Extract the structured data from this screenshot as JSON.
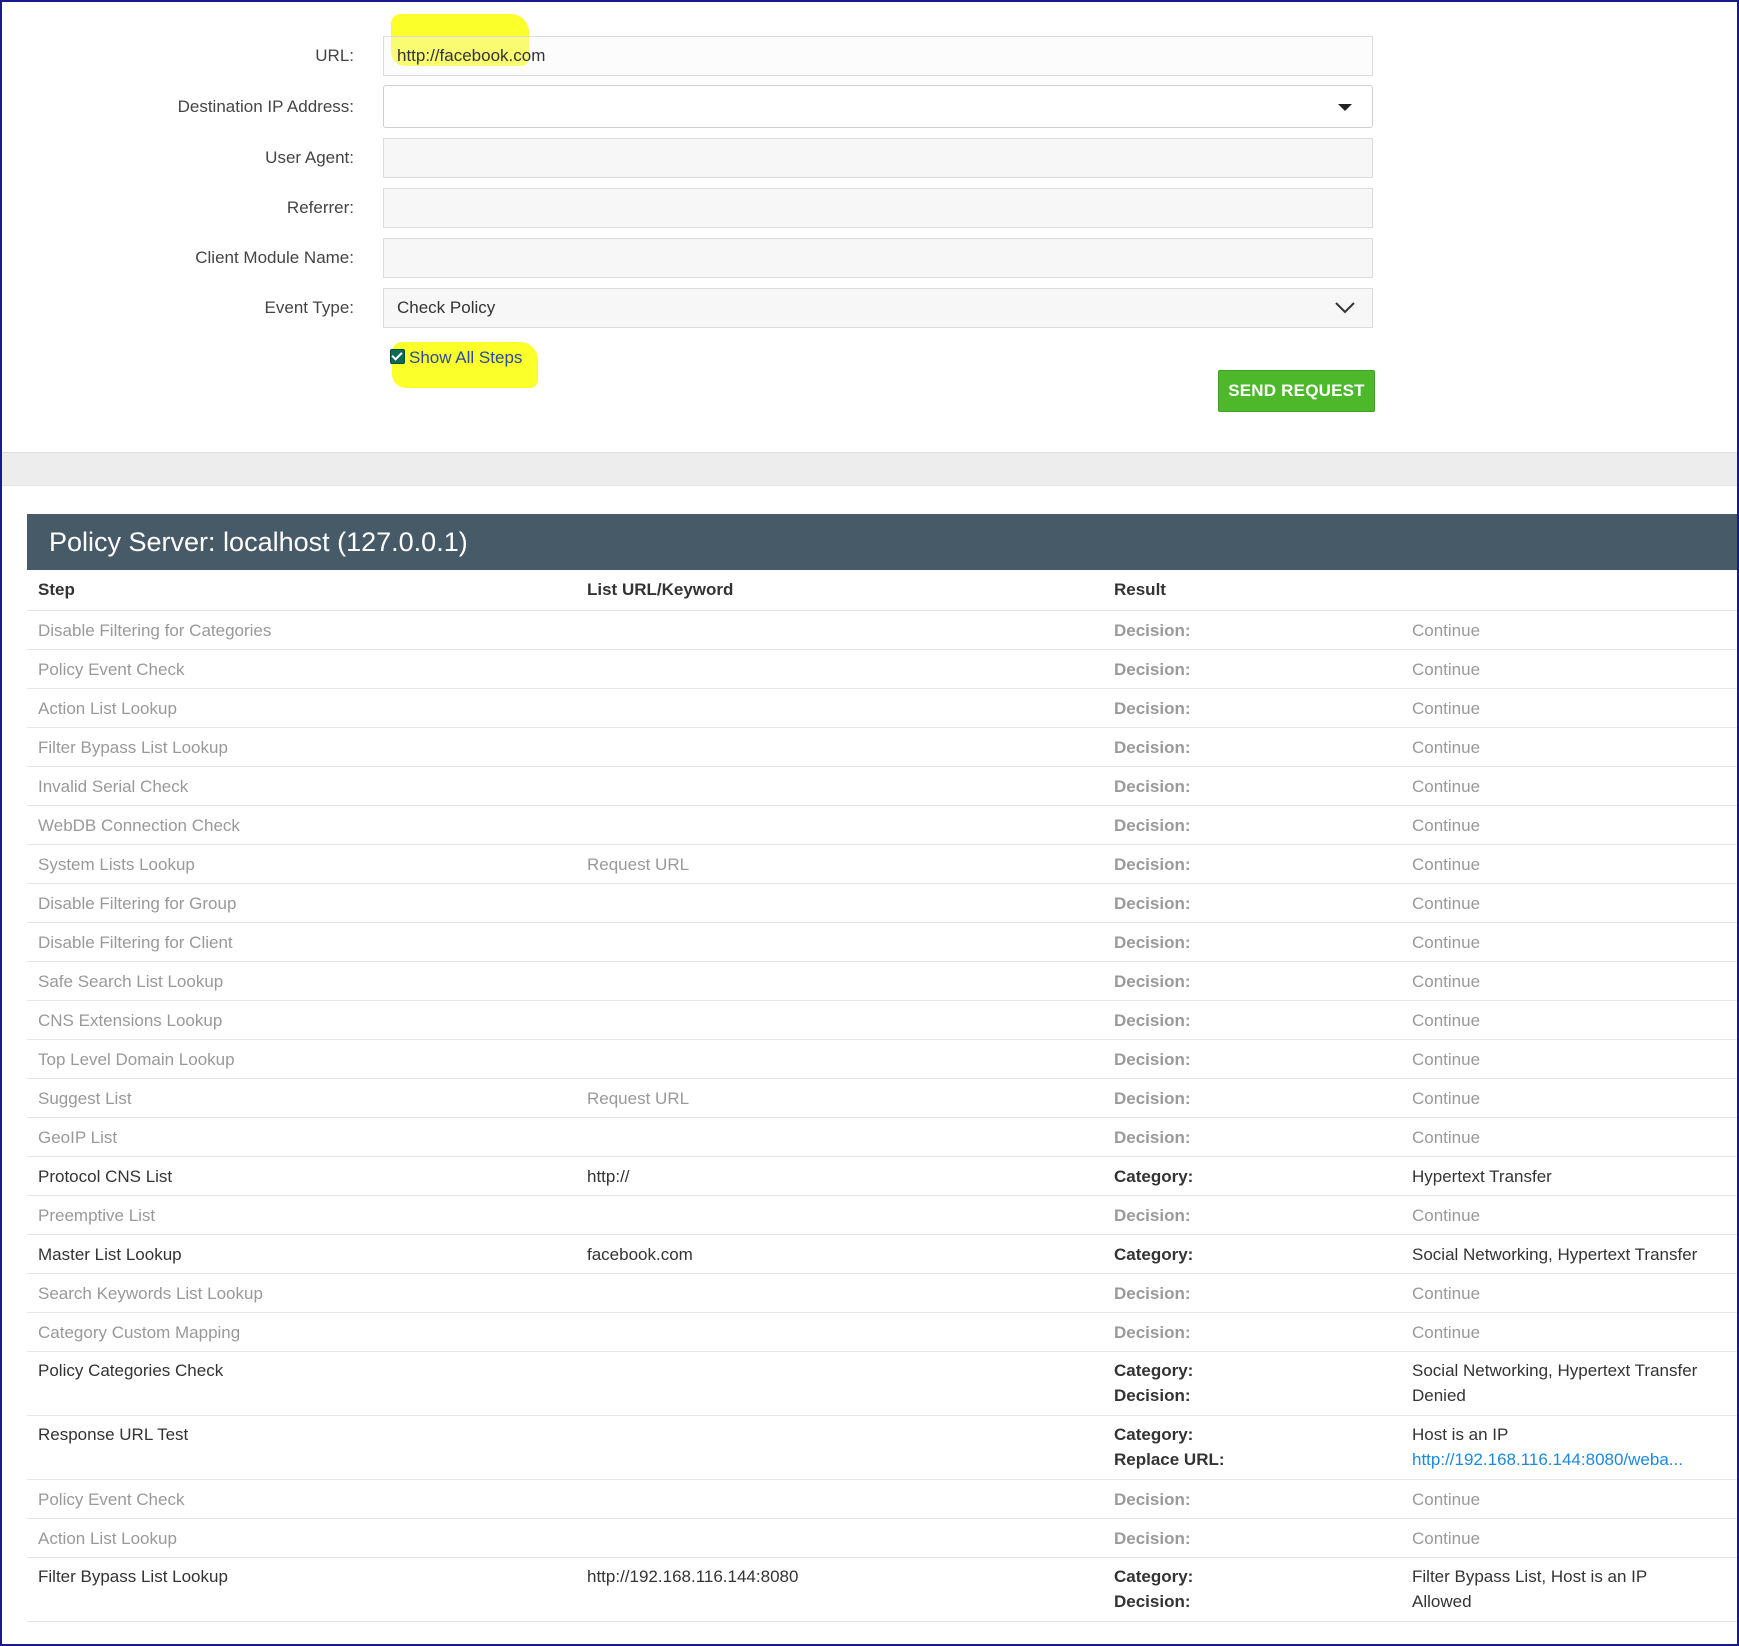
{
  "form": {
    "url_label": "URL:",
    "url_value": "http://facebook.com",
    "dest_ip_label": "Destination IP Address:",
    "dest_ip_value": "",
    "user_agent_label": "User Agent:",
    "referrer_label": "Referrer:",
    "client_module_label": "Client Module Name:",
    "event_type_label": "Event Type:",
    "event_type_value": "Check Policy",
    "show_all_steps_label": "Show All Steps",
    "show_all_steps_checked": true,
    "send_button": "SEND REQUEST"
  },
  "panel": {
    "title": "Policy Server: localhost (127.0.0.1)",
    "columns": [
      "Step",
      "List URL/Keyword",
      "Result",
      ""
    ],
    "rows": [
      {
        "step": "Disable Filtering for Categories",
        "keyword": "",
        "label1": "Decision:",
        "value1": "Continue"
      },
      {
        "step": "Policy Event Check",
        "keyword": "",
        "label1": "Decision:",
        "value1": "Continue"
      },
      {
        "step": "Action List Lookup",
        "keyword": "",
        "label1": "Decision:",
        "value1": "Continue"
      },
      {
        "step": "Filter Bypass List Lookup",
        "keyword": "",
        "label1": "Decision:",
        "value1": "Continue"
      },
      {
        "step": "Invalid Serial Check",
        "keyword": "",
        "label1": "Decision:",
        "value1": "Continue"
      },
      {
        "step": "WebDB Connection Check",
        "keyword": "",
        "label1": "Decision:",
        "value1": "Continue"
      },
      {
        "step": "System Lists Lookup",
        "keyword": "Request URL",
        "label1": "Decision:",
        "value1": "Continue"
      },
      {
        "step": "Disable Filtering for Group",
        "keyword": "",
        "label1": "Decision:",
        "value1": "Continue"
      },
      {
        "step": "Disable Filtering for Client",
        "keyword": "",
        "label1": "Decision:",
        "value1": "Continue"
      },
      {
        "step": "Safe Search List Lookup",
        "keyword": "",
        "label1": "Decision:",
        "value1": "Continue"
      },
      {
        "step": "CNS Extensions Lookup",
        "keyword": "",
        "label1": "Decision:",
        "value1": "Continue"
      },
      {
        "step": "Top Level Domain Lookup",
        "keyword": "",
        "label1": "Decision:",
        "value1": "Continue"
      },
      {
        "step": "Suggest List",
        "keyword": "Request URL",
        "label1": "Decision:",
        "value1": "Continue"
      },
      {
        "step": "GeoIP List",
        "keyword": "",
        "label1": "Decision:",
        "value1": "Continue"
      },
      {
        "step": "Protocol CNS List",
        "keyword": "http://",
        "label1": "Category:",
        "value1": "Hypertext Transfer"
      },
      {
        "step": "Preemptive List",
        "keyword": "",
        "label1": "Decision:",
        "value1": "Continue"
      },
      {
        "step": "Master List Lookup",
        "keyword": "facebook.com",
        "label1": "Category:",
        "value1": "Social Networking, Hypertext Transfer"
      },
      {
        "step": "Search Keywords List Lookup",
        "keyword": "",
        "label1": "Decision:",
        "value1": "Continue"
      },
      {
        "step": "Category Custom Mapping",
        "keyword": "",
        "label1": "Decision:",
        "value1": "Continue"
      },
      {
        "step": "Policy Categories Check",
        "keyword": "",
        "label1": "Category:",
        "value1": "Social Networking, Hypertext Transfer",
        "label2": "Decision:",
        "value2": "Denied"
      },
      {
        "step": "Response URL Test",
        "keyword": "",
        "label1": "Category:",
        "value1": "Host is an IP",
        "label2": "Replace URL:",
        "value2": "http://192.168.116.144:8080/weba..."
      },
      {
        "step": "Policy Event Check",
        "keyword": "",
        "label1": "Decision:",
        "value1": "Continue"
      },
      {
        "step": "Action List Lookup",
        "keyword": "",
        "label1": "Decision:",
        "value1": "Continue"
      },
      {
        "step": "Filter Bypass List Lookup",
        "keyword": "http://192.168.116.144:8080",
        "label1": "Category:",
        "value1": "Filter Bypass List, Host is an IP",
        "label2": "Decision:",
        "value2": "Allowed"
      }
    ]
  }
}
